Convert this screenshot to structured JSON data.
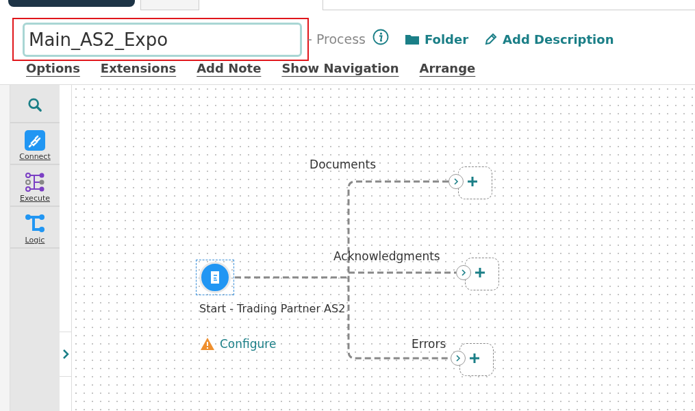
{
  "process_name": {
    "value": "Main_AS2_Expo"
  },
  "header": {
    "type_label": "- Process",
    "links": [
      {
        "kind": "folder",
        "label": "Folder"
      },
      {
        "kind": "edit",
        "label": "Add Description"
      }
    ]
  },
  "menu": [
    "Options",
    "Extensions",
    "Add Note",
    "Show Navigation",
    "Arrange"
  ],
  "palette": [
    {
      "kind": "search"
    },
    {
      "kind": "connect",
      "label": "Connect"
    },
    {
      "kind": "execute",
      "label": "Execute"
    },
    {
      "kind": "logic",
      "label": "Logic"
    }
  ],
  "canvas": {
    "start": {
      "title": "Start - Trading Partner AS2",
      "action": "Configure",
      "warning": true
    },
    "branches": [
      {
        "label": "Documents"
      },
      {
        "label": "Acknowledgments"
      },
      {
        "label": "Errors"
      }
    ]
  }
}
